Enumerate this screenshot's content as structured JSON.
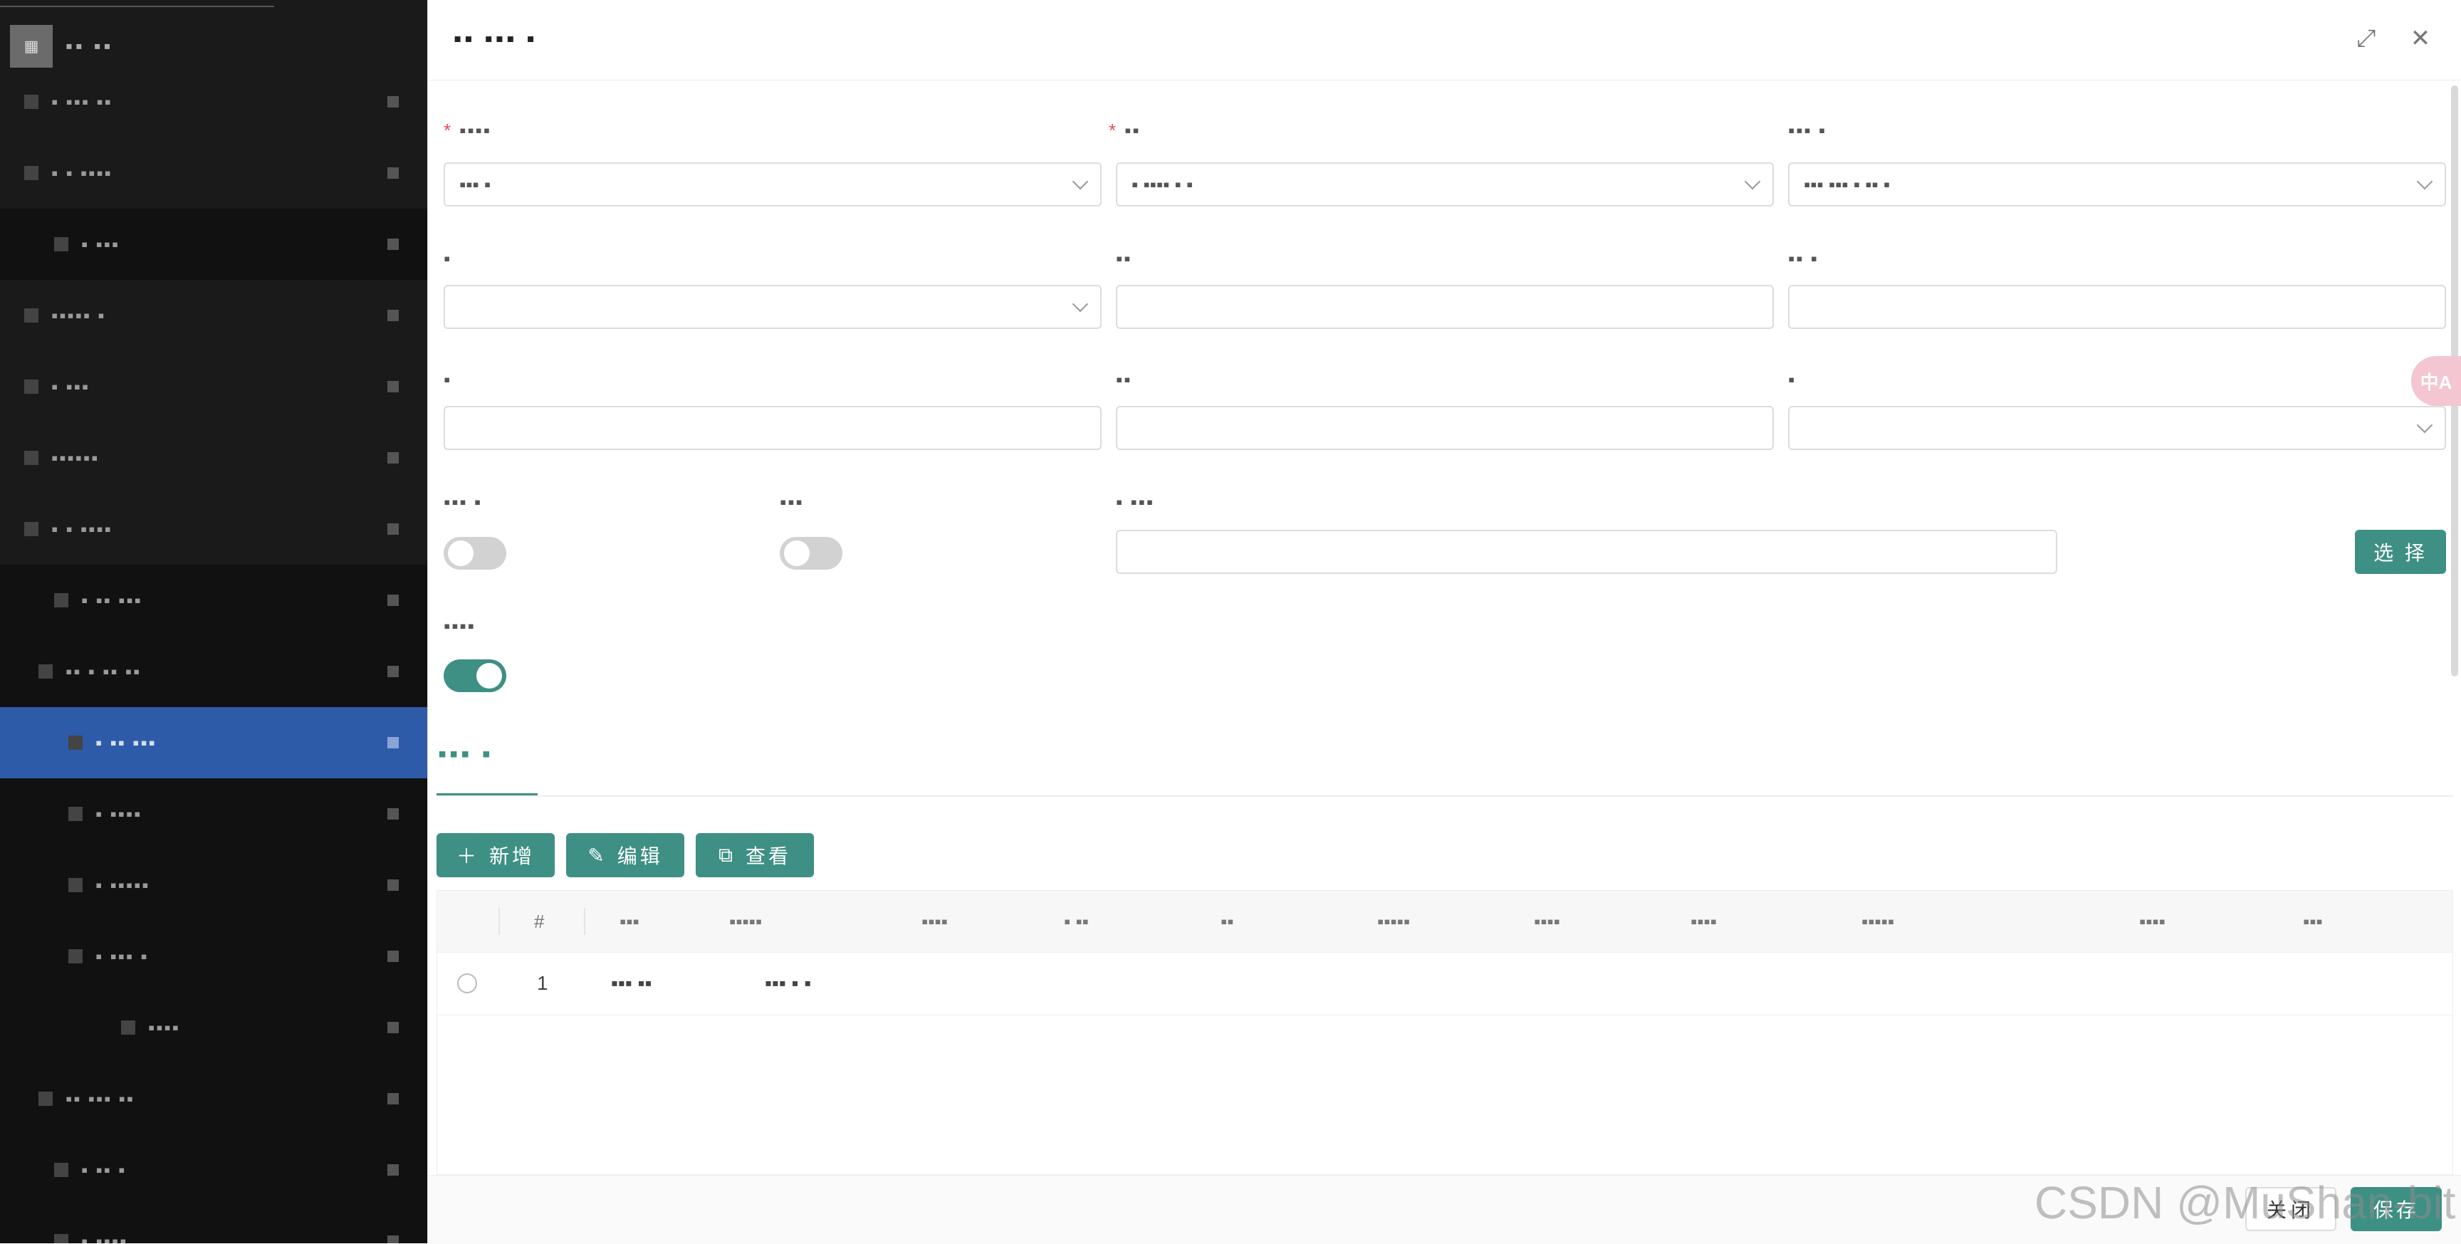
{
  "sidebar": {
    "title": "▪▪ ▪▪",
    "items": [
      {
        "label": "▪ ▪▪▪ ▪▪"
      },
      {
        "label": "▪ ▪ ▪▪▪▪"
      },
      {
        "label": "▪ ▪▪▪"
      },
      {
        "label": "▪▪▪▪▪ ▪"
      },
      {
        "label": "▪ ▪▪▪"
      },
      {
        "label": "▪▪▪▪▪▪"
      },
      {
        "label": "▪ ▪ ▪▪▪▪"
      },
      {
        "label": "▪ ▪▪ ▪▪▪"
      },
      {
        "label": "▪▪ ▪ ▪▪ ▪▪"
      },
      {
        "label": "▪ ▪▪ ▪▪▪"
      },
      {
        "label": "▪ ▪▪▪▪"
      },
      {
        "label": "▪ ▪▪▪▪▪"
      },
      {
        "label": "▪ ▪▪▪ ▪"
      },
      {
        "label": "▪▪▪▪"
      },
      {
        "label": "▪▪ ▪▪▪ ▪▪"
      },
      {
        "label": "▪ ▪▪ ▪"
      },
      {
        "label": "▪ ▪▪▪▪"
      }
    ]
  },
  "dialog": {
    "title": "▪▪ ▪▪▪ ▪",
    "maximize_icon": "⤢",
    "close_icon": "✕"
  },
  "form": {
    "f1": {
      "label": "▪▪▪▪",
      "value": "▪▪▪ ▪"
    },
    "f2": {
      "label": "▪▪",
      "value": "▪ ▪▪▪▪ ▪ ▪"
    },
    "f3": {
      "label": "▪▪▪ ▪",
      "value": "▪▪▪ ▪▪▪ ▪ ▪▪ ▪"
    },
    "f4": {
      "label": "▪",
      "value": ""
    },
    "f5": {
      "label": "▪▪",
      "value": ""
    },
    "f6": {
      "label": "▪▪ ▪",
      "value": ""
    },
    "f7": {
      "label": "▪",
      "value": ""
    },
    "f8": {
      "label": "▪▪",
      "value": ""
    },
    "f9": {
      "label": "▪",
      "value": ""
    },
    "s1": {
      "label": "▪▪▪ ▪",
      "on": false
    },
    "s2": {
      "label": "▪▪▪",
      "on": false
    },
    "f10": {
      "label": "▪ ▪▪▪",
      "value": ""
    },
    "s3": {
      "label": "▪▪▪▪",
      "on": true
    },
    "select_button": "选 择"
  },
  "tab": {
    "label": "▪▪▪ ▪"
  },
  "toolbar": {
    "add": "新增",
    "edit": "编辑",
    "view": "查看"
  },
  "table": {
    "columns": [
      "#",
      "▪▪▪",
      "▪▪▪▪▪",
      "▪▪▪▪",
      "▪ ▪▪",
      "▪▪",
      "▪▪▪▪▪",
      "▪▪▪▪",
      "▪▪▪▪",
      "▪▪▪▪▪",
      "▪▪▪▪",
      "▪▪▪"
    ],
    "rows": [
      {
        "index": "1",
        "c1": "▪▪▪  ▪▪",
        "c2": "▪▪▪ ▪ ▪"
      }
    ]
  },
  "footer": {
    "close": "关闭",
    "save": "保存"
  },
  "badge": "中A",
  "watermark": "CSDN @MuShan-bit"
}
